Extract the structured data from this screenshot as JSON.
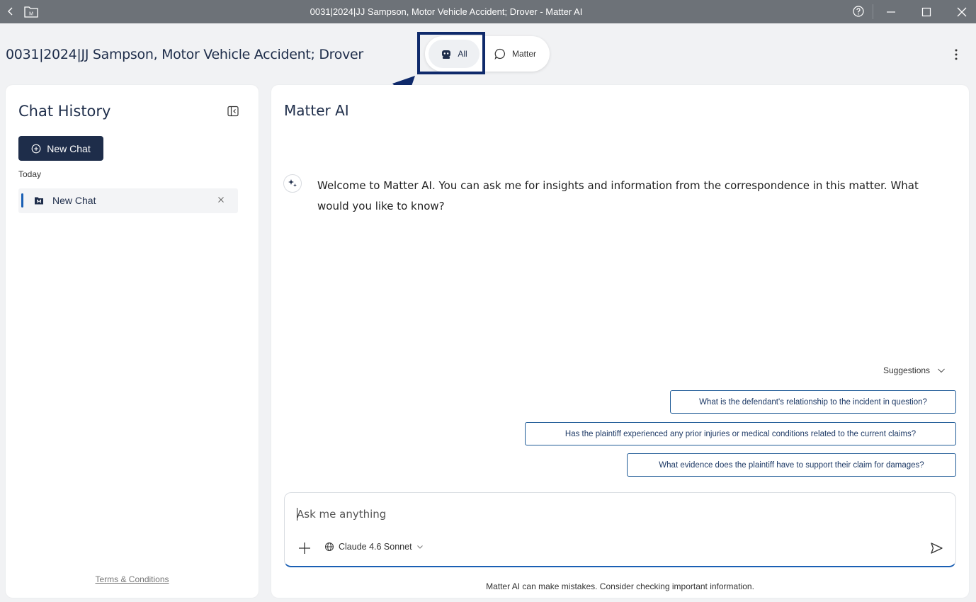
{
  "window": {
    "title": "0031|2024|JJ Sampson, Motor Vehicle Accident; Drover - Matter AI",
    "app_icon_letter": "M"
  },
  "header": {
    "matter_title": "0031|2024|JJ Sampson, Motor Vehicle Accident; Drover",
    "mode_toggle": {
      "options": [
        {
          "label": "All",
          "icon": "robot-icon",
          "selected": true
        },
        {
          "label": "Matter",
          "icon": "chat-bubble-icon",
          "selected": false
        }
      ]
    }
  },
  "sidebar": {
    "title": "Chat History",
    "new_chat_label": "New Chat",
    "group_label": "Today",
    "items": [
      {
        "label": "New Chat",
        "icon": "folder-m-icon",
        "active": true
      }
    ],
    "terms_label": "Terms & Conditions"
  },
  "main": {
    "title": "Matter AI",
    "welcome_message": "Welcome to Matter AI. You can ask me for insights and information from the correspondence in this matter. What would you like to know?",
    "suggestions_label": "Suggestions",
    "suggestions": [
      "What is the defendant's relationship to the incident in question?",
      "Has the plaintiff experienced any prior injuries or medical conditions related to the current claims?",
      "What evidence does the plaintiff have to support their claim for damages?"
    ],
    "composer": {
      "placeholder": "Ask me anything",
      "model_label": "Claude 4.6 Sonnet"
    },
    "disclaimer": "Matter AI can make mistakes. Consider checking important information."
  },
  "colors": {
    "titlebar": "#6d7278",
    "navy": "#1e2d4a",
    "accent_blue": "#1a5fb4",
    "annotation": "#0f2a6b"
  }
}
